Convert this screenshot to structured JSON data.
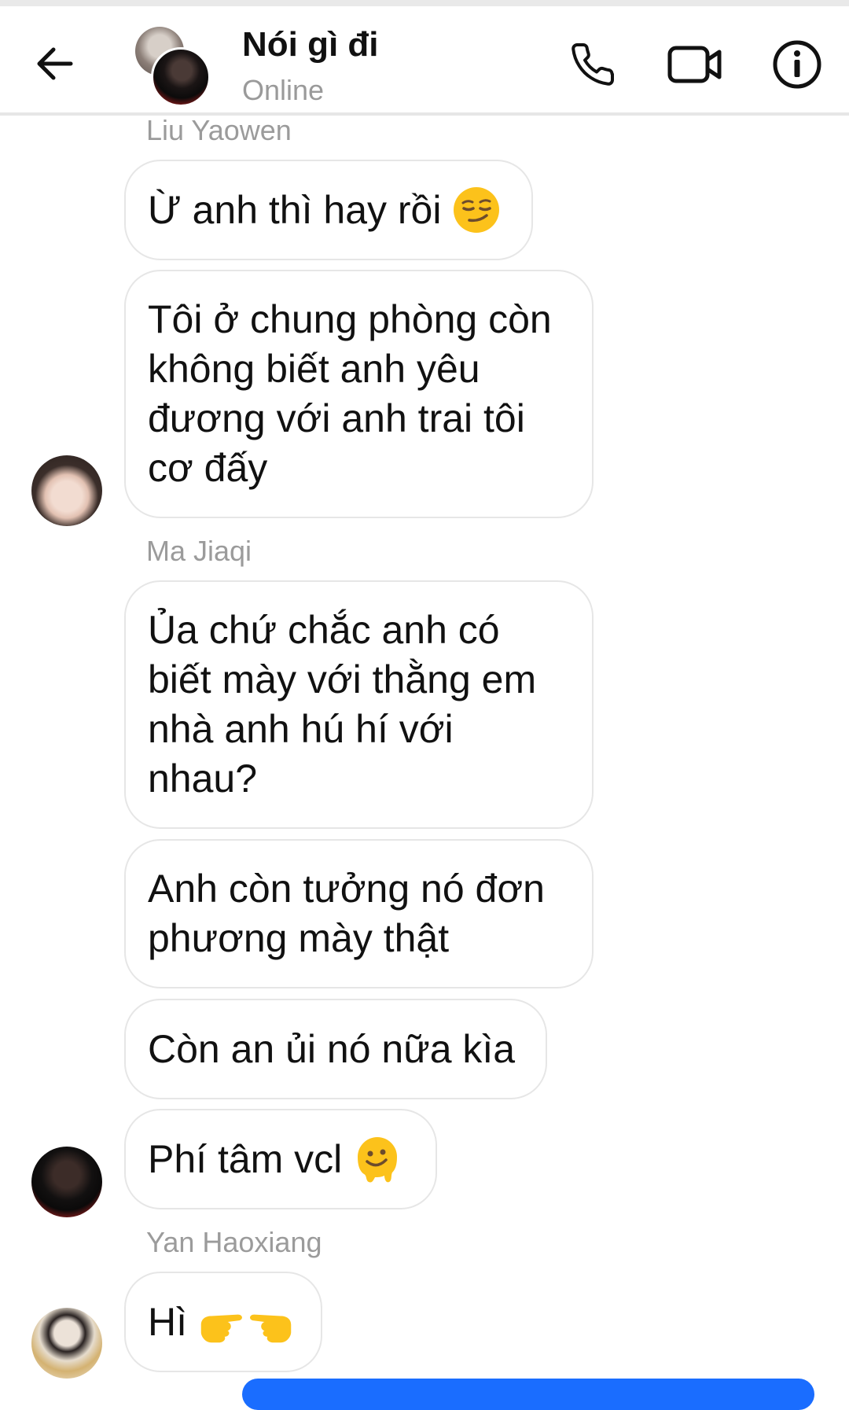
{
  "header": {
    "title": "Nói gì đi",
    "status": "Online"
  },
  "messages": [
    {
      "sender_name": "Liu Yaowen",
      "text": "Ừ anh thì hay rồi",
      "emoji": "smirking-face-emoji"
    },
    {
      "text": "Tôi ở chung phòng còn không biết anh yêu đương với anh trai tôi cơ đấy"
    },
    {
      "sender_name": "Ma Jiaqi",
      "text": "Ủa chứ chắc anh có biết mày với thằng em nhà anh hú hí với nhau?"
    },
    {
      "text": "Anh còn tưởng nó đơn phương mày thật"
    },
    {
      "text": "Còn an ủi nó nữa kìa"
    },
    {
      "text": "Phí tâm vcl",
      "emoji": "melting-face-emoji"
    },
    {
      "sender_name": "Yan Haoxiang",
      "text": "Hì",
      "emoji": "pointing-hands-emoji"
    }
  ],
  "colors": {
    "accent": "#1a6dff",
    "bubble_border": "#e6e6e6",
    "name_gray": "#9b9b9b",
    "emoji_yellow": "#fcc21b"
  }
}
